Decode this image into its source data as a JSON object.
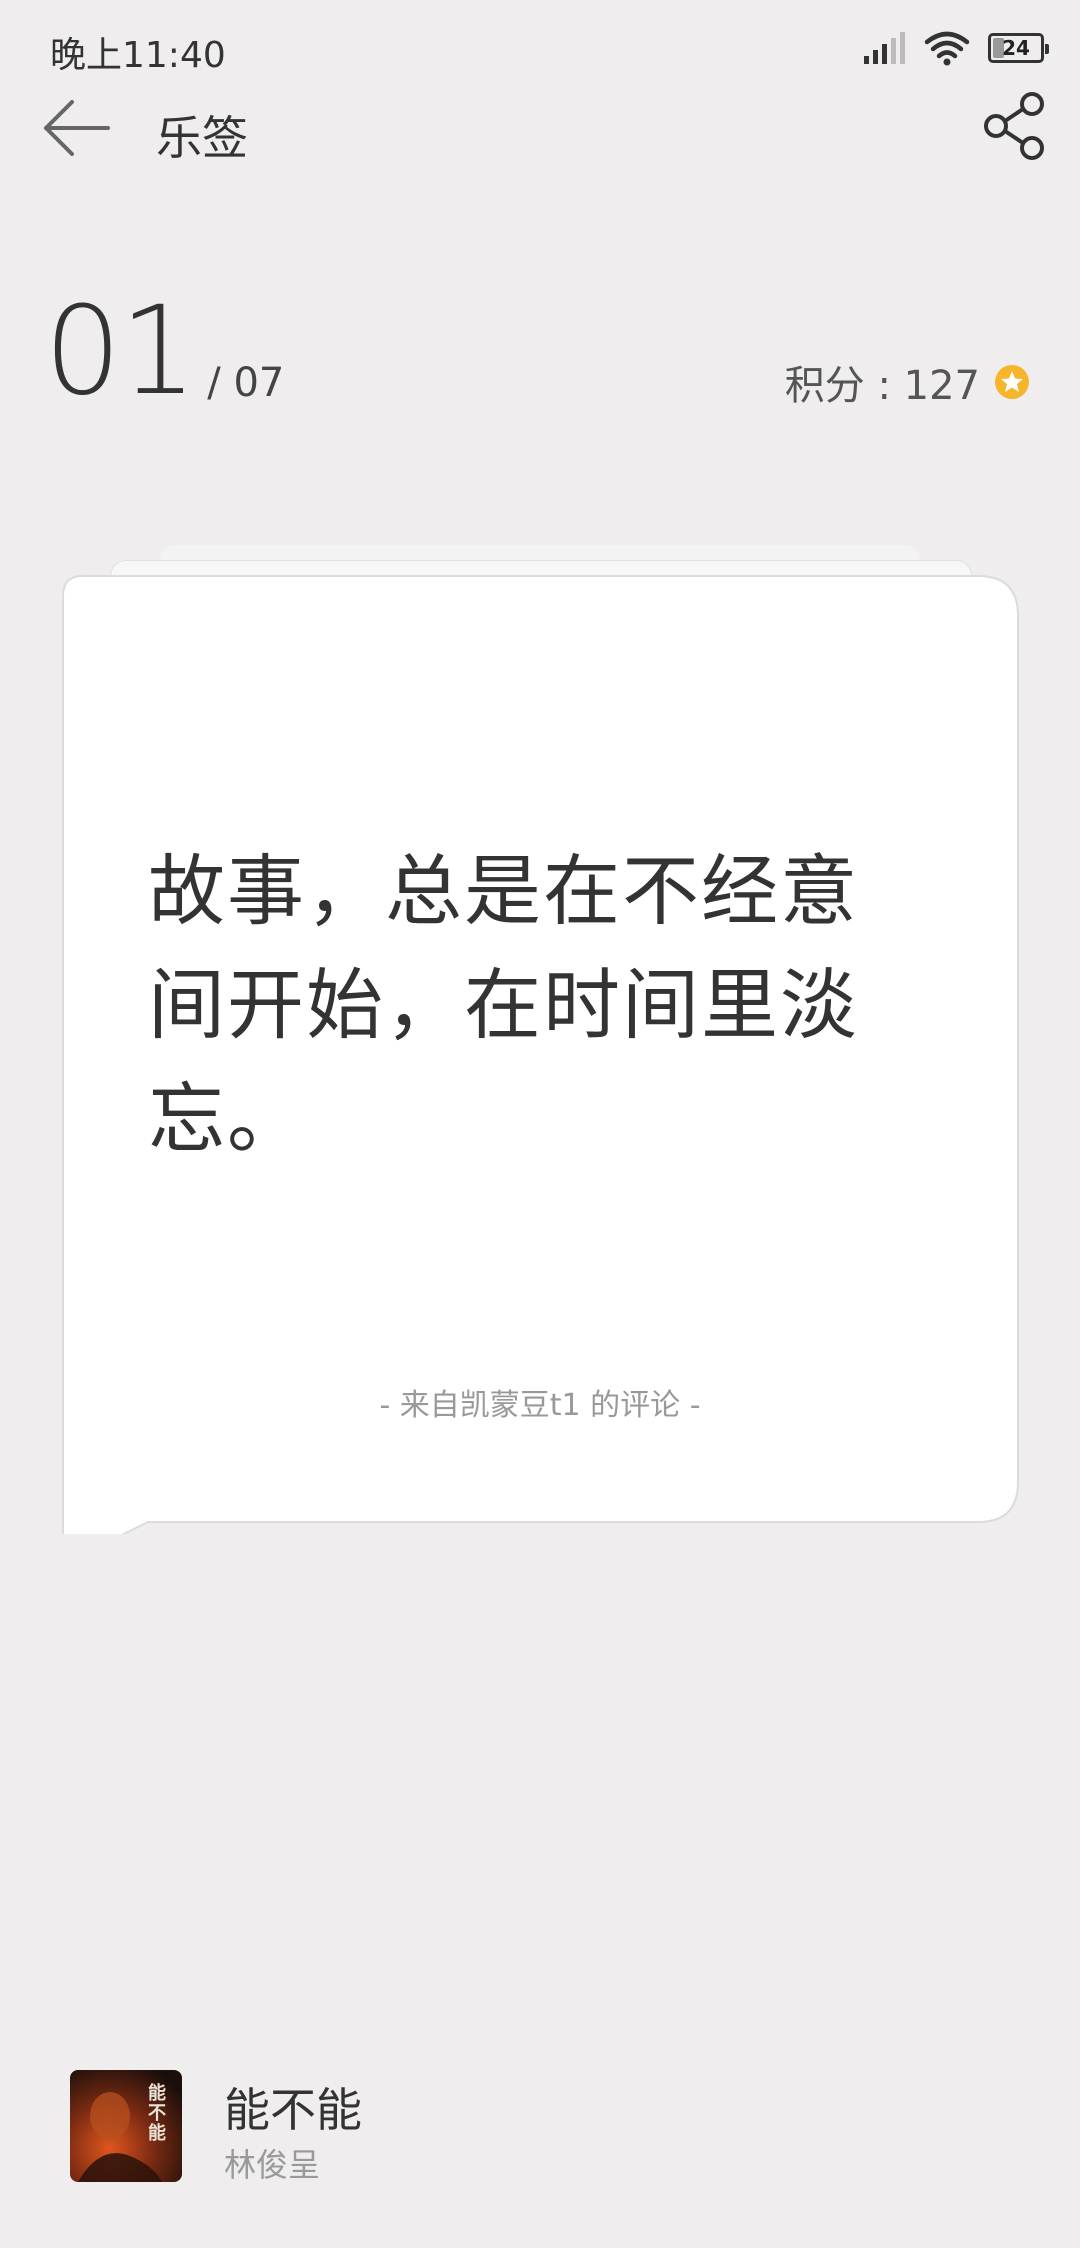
{
  "status_bar": {
    "time": "晚上11:40",
    "battery_level": "24",
    "battery_fraction": 0.24,
    "icons": [
      "signal-icon",
      "wifi-icon",
      "battery-icon"
    ]
  },
  "header": {
    "title": "乐签",
    "icons": [
      "back-arrow-icon",
      "share-icon"
    ]
  },
  "counter": {
    "current": "01",
    "total": "/ 07"
  },
  "score": {
    "label": "积分 : 127",
    "icon": "star-coin-icon",
    "icon_color": "#f7b52c"
  },
  "card": {
    "quote": "故事，总是在不经意间开始，在时间里淡忘。",
    "source": "- 来自凯蒙豆t1 的评论 -"
  },
  "now_playing": {
    "title": "能不能",
    "artist": "林俊呈",
    "album_icon": "album-art-icon",
    "album_text": "能不能"
  }
}
